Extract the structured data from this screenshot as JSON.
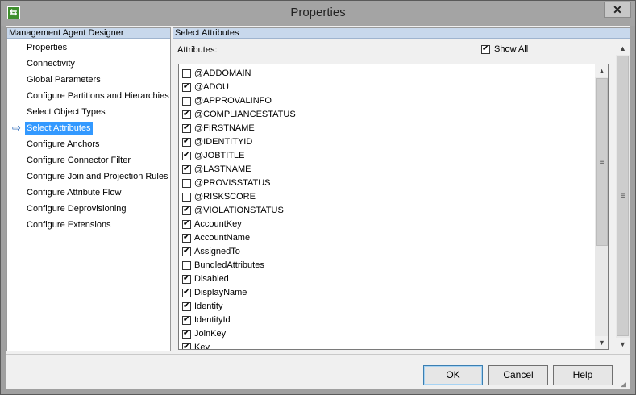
{
  "window": {
    "title": "Properties",
    "close": "✕"
  },
  "left_panel": {
    "header": "Management Agent Designer",
    "items": [
      {
        "label": "Properties"
      },
      {
        "label": "Connectivity"
      },
      {
        "label": "Global Parameters"
      },
      {
        "label": "Configure Partitions and Hierarchies"
      },
      {
        "label": "Select Object Types"
      },
      {
        "label": "Select Attributes",
        "selected": true
      },
      {
        "label": "Configure Anchors"
      },
      {
        "label": "Configure Connector Filter"
      },
      {
        "label": "Configure Join and Projection Rules"
      },
      {
        "label": "Configure Attribute Flow"
      },
      {
        "label": "Configure Deprovisioning"
      },
      {
        "label": "Configure Extensions"
      }
    ]
  },
  "right_panel": {
    "header": "Select Attributes",
    "attributes_label": "Attributes:",
    "show_all": {
      "label": "Show All",
      "checked": true
    },
    "attributes": [
      {
        "name": "@ADDOMAIN",
        "checked": false
      },
      {
        "name": "@ADOU",
        "checked": true
      },
      {
        "name": "@APPROVALINFO",
        "checked": false
      },
      {
        "name": "@COMPLIANCESTATUS",
        "checked": true
      },
      {
        "name": "@FIRSTNAME",
        "checked": true
      },
      {
        "name": "@IDENTITYID",
        "checked": true
      },
      {
        "name": "@JOBTITLE",
        "checked": true
      },
      {
        "name": "@LASTNAME",
        "checked": true
      },
      {
        "name": "@PROVISSTATUS",
        "checked": false
      },
      {
        "name": "@RISKSCORE",
        "checked": false
      },
      {
        "name": "@VIOLATIONSTATUS",
        "checked": true
      },
      {
        "name": "AccountKey",
        "checked": true
      },
      {
        "name": "AccountName",
        "checked": true
      },
      {
        "name": "AssignedTo",
        "checked": true
      },
      {
        "name": "BundledAttributes",
        "checked": false
      },
      {
        "name": "Disabled",
        "checked": true
      },
      {
        "name": "DisplayName",
        "checked": true
      },
      {
        "name": "Identity",
        "checked": true
      },
      {
        "name": "IdentityId",
        "checked": true
      },
      {
        "name": "JoinKey",
        "checked": true
      },
      {
        "name": "Key",
        "checked": true
      }
    ]
  },
  "buttons": {
    "ok": "OK",
    "cancel": "Cancel",
    "help": "Help"
  },
  "icons": {
    "nav_arrow": "⇨",
    "scroll_up": "▲",
    "scroll_down": "▼",
    "grip": "≡"
  }
}
